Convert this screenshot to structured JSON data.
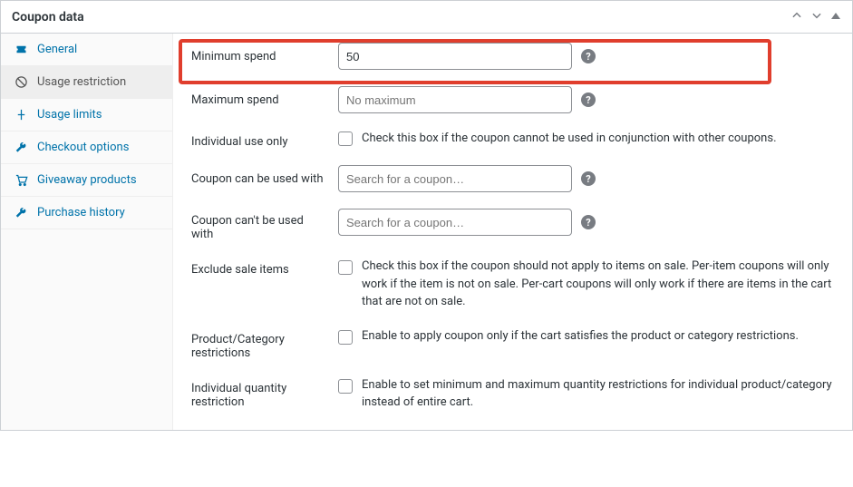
{
  "header": {
    "title": "Coupon data"
  },
  "sidebar": {
    "items": [
      {
        "label": "General"
      },
      {
        "label": "Usage restriction"
      },
      {
        "label": "Usage limits"
      },
      {
        "label": "Checkout options"
      },
      {
        "label": "Giveaway products"
      },
      {
        "label": "Purchase history"
      }
    ]
  },
  "form": {
    "min_spend": {
      "label": "Minimum spend",
      "value": "50"
    },
    "max_spend": {
      "label": "Maximum spend",
      "placeholder": "No maximum"
    },
    "individual_use": {
      "label": "Individual use only",
      "desc": "Check this box if the coupon cannot be used in conjunction with other coupons."
    },
    "can_use_with": {
      "label": "Coupon can be used with",
      "placeholder": "Search for a coupon…"
    },
    "cant_use_with": {
      "label": "Coupon can't be used with",
      "placeholder": "Search for a coupon…"
    },
    "exclude_sale": {
      "label": "Exclude sale items",
      "desc": "Check this box if the coupon should not apply to items on sale. Per-item coupons will only work if the item is not on sale. Per-cart coupons will only work if there are items in the cart that are not on sale."
    },
    "prod_cat": {
      "label": "Product/Category restrictions",
      "desc": "Enable to apply coupon only if the cart satisfies the product or category restrictions."
    },
    "ind_qty": {
      "label": "Individual quantity restriction",
      "desc": "Enable to set minimum and maximum quantity restrictions for individual product/category instead of entire cart."
    }
  }
}
